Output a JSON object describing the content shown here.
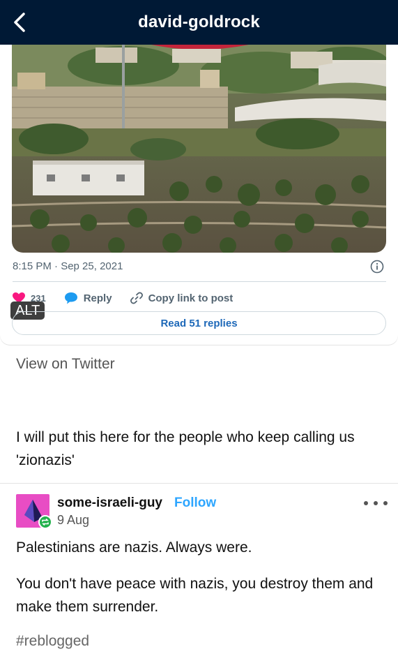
{
  "header": {
    "title": "david-goldrock"
  },
  "tweet": {
    "timestamp": "8:15 PM · Sep 25, 2021",
    "likes": "231",
    "reply_label": "Reply",
    "copy_link_label": "Copy link to post",
    "alt_label": "ALT",
    "read_replies_label": "Read 51 replies"
  },
  "view_on_twitter": "View on Twitter",
  "post": {
    "text": "I will put this here for the people who keep calling us 'zionazis'"
  },
  "reblog": {
    "username": "some-israeli-guy",
    "follow_label": "Follow",
    "date": "9 Aug",
    "paragraph1": "Palestinians are nazis. Always were.",
    "paragraph2": "You don't have peace with nazis, you destroy them and make them surrender.",
    "tag": "#reblogged"
  },
  "colors": {
    "header_bg": "#001935",
    "link_blue": "#1d68b8",
    "follow_blue": "#2ea6ff",
    "like_red": "#f91880",
    "avatar_pink": "#e84dc4",
    "reblog_green": "#22b14c"
  },
  "icons": [
    "chevron-left-icon",
    "info-icon",
    "heart-icon",
    "reply-bubble-icon",
    "link-icon",
    "reblog-icon",
    "more-dots-icon"
  ]
}
